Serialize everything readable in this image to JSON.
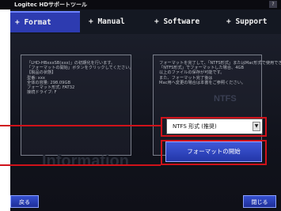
{
  "window": {
    "title": "Logitec HDサポートツール",
    "help_label": "?"
  },
  "tabs": [
    {
      "label": "+ Format",
      "active": true
    },
    {
      "label": "+ Manual",
      "active": false
    },
    {
      "label": "+ Software",
      "active": false
    },
    {
      "label": "+ Support",
      "active": false
    }
  ],
  "info_panel": {
    "text": "「LHD-HBxxxSB(xxx)」の初期化を行います。\n「フォーマットの開始」ボタンをクリックしてください。\n【製品の状態】\n型番: xxx\n全体の容量: 298.09GB\nフォーマット形式: FAT32\n接続ドライブ: F",
    "watermark": "Information"
  },
  "format_panel": {
    "text": "フォーマットを完了して、「NTFS形式」またはMac形式で使用できます。\n「NTFS形式」でフォーマットした場合、4GB\n以上のファイルの保存が可能です。\nまた、フォーマット完了後は\nMac用へ変更の場合は本書をご参照ください。",
    "watermark": "NTFS"
  },
  "format_select": {
    "value": "NTFS 形式 (推奨)",
    "arrow_icon": "▼"
  },
  "buttons": {
    "start_format": "フォーマットの開始",
    "back": "戻る",
    "close": "閉じる"
  },
  "colors": {
    "tab_active": "#2d3bb0",
    "callout": "#d0121a",
    "button": "#2336a8"
  }
}
